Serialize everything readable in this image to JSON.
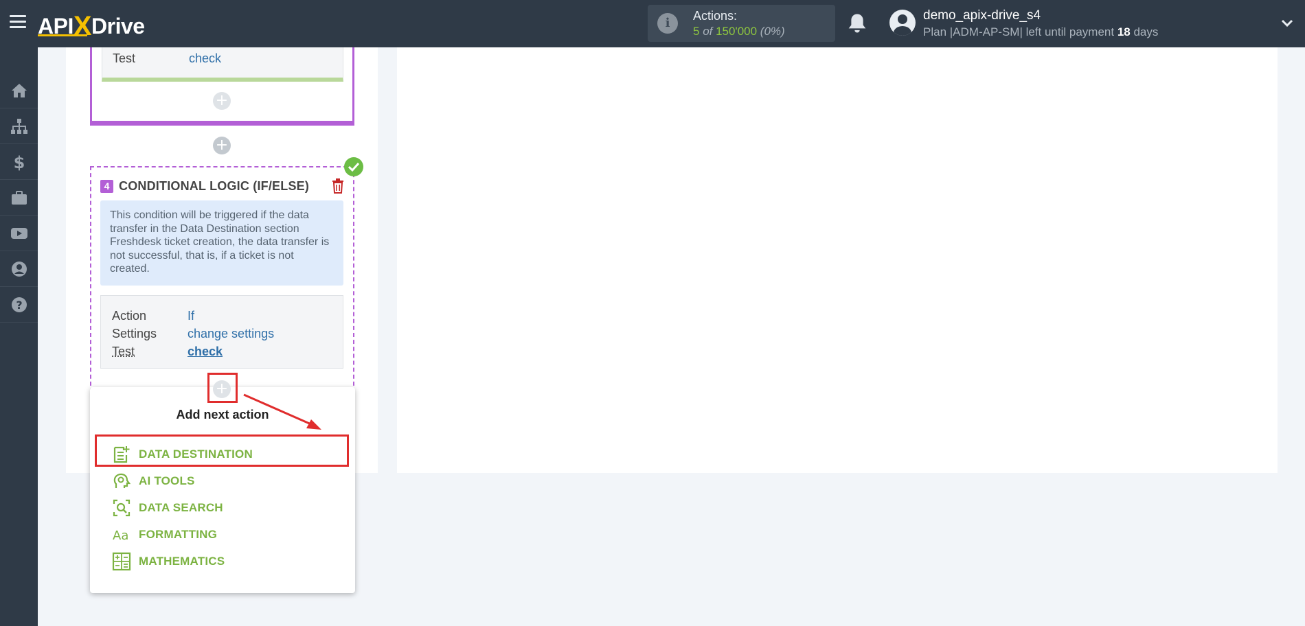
{
  "header": {
    "logo_text_a": "API",
    "logo_text_x": "X",
    "logo_text_b": "Drive",
    "actions_label": "Actions:",
    "actions_used": "5",
    "actions_of": " of ",
    "actions_total": "150'000",
    "actions_pct": " (0%)",
    "username": "demo_apix-drive_s4",
    "plan_prefix": "Plan |ADM-AP-SM| left until payment ",
    "plan_days": "18",
    "plan_suffix": " days"
  },
  "sidebar": {
    "items": [
      "home-icon",
      "sitemap-icon",
      "dollar-icon",
      "briefcase-icon",
      "youtube-icon",
      "user-circle-icon",
      "help-icon"
    ]
  },
  "prev_card": {
    "test_label": "Test",
    "test_value": "check"
  },
  "cond_card": {
    "step": "4",
    "title": "CONDITIONAL LOGIC (IF/ELSE)",
    "note": "This condition will be triggered if the data transfer in the Data Destination section Freshdesk ticket creation, the data transfer is not successful, that is, if a ticket is not created.",
    "rows": [
      {
        "label": "Action",
        "value": "If"
      },
      {
        "label": "Settings",
        "value": "change settings"
      },
      {
        "label": "Test",
        "value": "check"
      }
    ]
  },
  "dropdown": {
    "title": "Add next action",
    "items": [
      {
        "label": "DATA DESTINATION",
        "icon": "data-destination-icon"
      },
      {
        "label": "AI TOOLS",
        "icon": "ai-tools-icon"
      },
      {
        "label": "DATA SEARCH",
        "icon": "data-search-icon"
      },
      {
        "label": "FORMATTING",
        "icon": "formatting-icon"
      },
      {
        "label": "MATHEMATICS",
        "icon": "mathematics-icon"
      }
    ]
  },
  "colors": {
    "topbar": "#2f3a47",
    "accent_purple": "#b35fd6",
    "accent_green": "#7cb342",
    "highlight_red": "#e02d2d",
    "link_blue": "#2f6fa8"
  }
}
